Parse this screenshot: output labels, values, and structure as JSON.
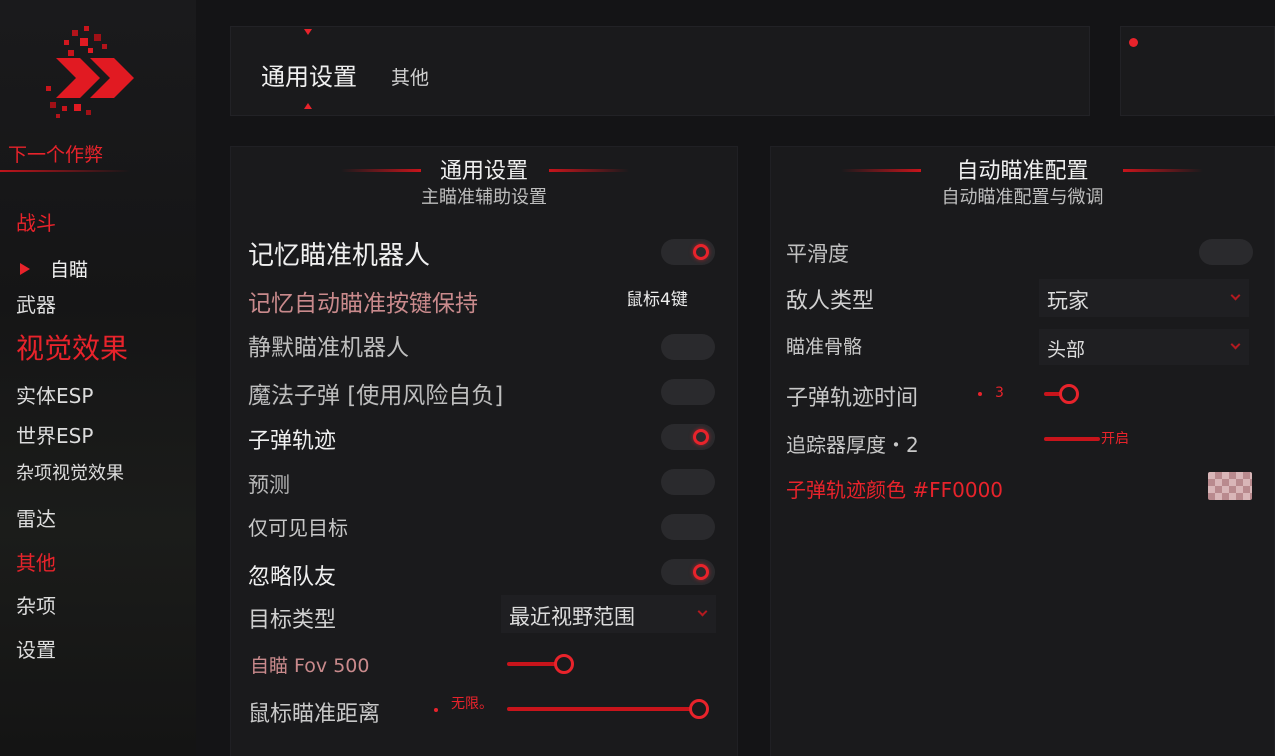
{
  "brand": {
    "name": "下一个作弊"
  },
  "colors": {
    "accent": "#e8232b",
    "panel": "#1a1a1c",
    "background": "#141416"
  },
  "sidebar": {
    "combat": "战斗",
    "aimbot": "自瞄",
    "weapons": "武器",
    "visuals": "视觉效果",
    "entity_esp": "实体ESP",
    "world_esp": "世界ESP",
    "misc_visuals": "杂项视觉效果",
    "radar": "雷达",
    "other": "其他",
    "misc": "杂项",
    "settings": "设置"
  },
  "tabs": {
    "main": "通用设置",
    "other": "其他"
  },
  "left_panel": {
    "title": "通用设置",
    "subtitle": "主瞄准辅助设置",
    "memory_aimbot": {
      "label": "记忆瞄准机器人",
      "on": true
    },
    "hold_key": {
      "label": "记忆自动瞄准按键保持",
      "value": "鼠标4键"
    },
    "silent_aimbot": {
      "label": "静默瞄准机器人",
      "on": false
    },
    "magic_bullet": {
      "label": "魔法子弹 [使用风险自负]",
      "on": false
    },
    "bullet_trace": {
      "label": "子弹轨迹",
      "on": true
    },
    "prediction": {
      "label": "预测",
      "on": false
    },
    "visible_only": {
      "label": "仅可见目标",
      "on": false
    },
    "ignore_team": {
      "label": "忽略队友",
      "on": true
    },
    "target_type": {
      "label": "目标类型",
      "value": "最近视野范围"
    },
    "fov": {
      "label": "自瞄 Fov 500",
      "value": 500,
      "fraction": 0.27
    },
    "distance": {
      "label": "鼠标瞄准距离",
      "value_text": "无限。",
      "fraction": 1.0
    }
  },
  "right_panel": {
    "title": "自动瞄准配置",
    "subtitle": "自动瞄准配置与微调",
    "smoothness": {
      "label": "平滑度",
      "on": false
    },
    "enemy_type": {
      "label": "敌人类型",
      "value": "玩家"
    },
    "aim_bone": {
      "label": "瞄准骨骼",
      "value": "头部"
    },
    "trace_time": {
      "label": "子弹轨迹时间",
      "value": "3",
      "fraction": 0.5
    },
    "tracker_thickness": {
      "label": "追踪器厚度・2",
      "value_text": "开启",
      "fraction": 1.0
    },
    "trace_color": {
      "label": "子弹轨迹颜色 #FF0000"
    }
  }
}
